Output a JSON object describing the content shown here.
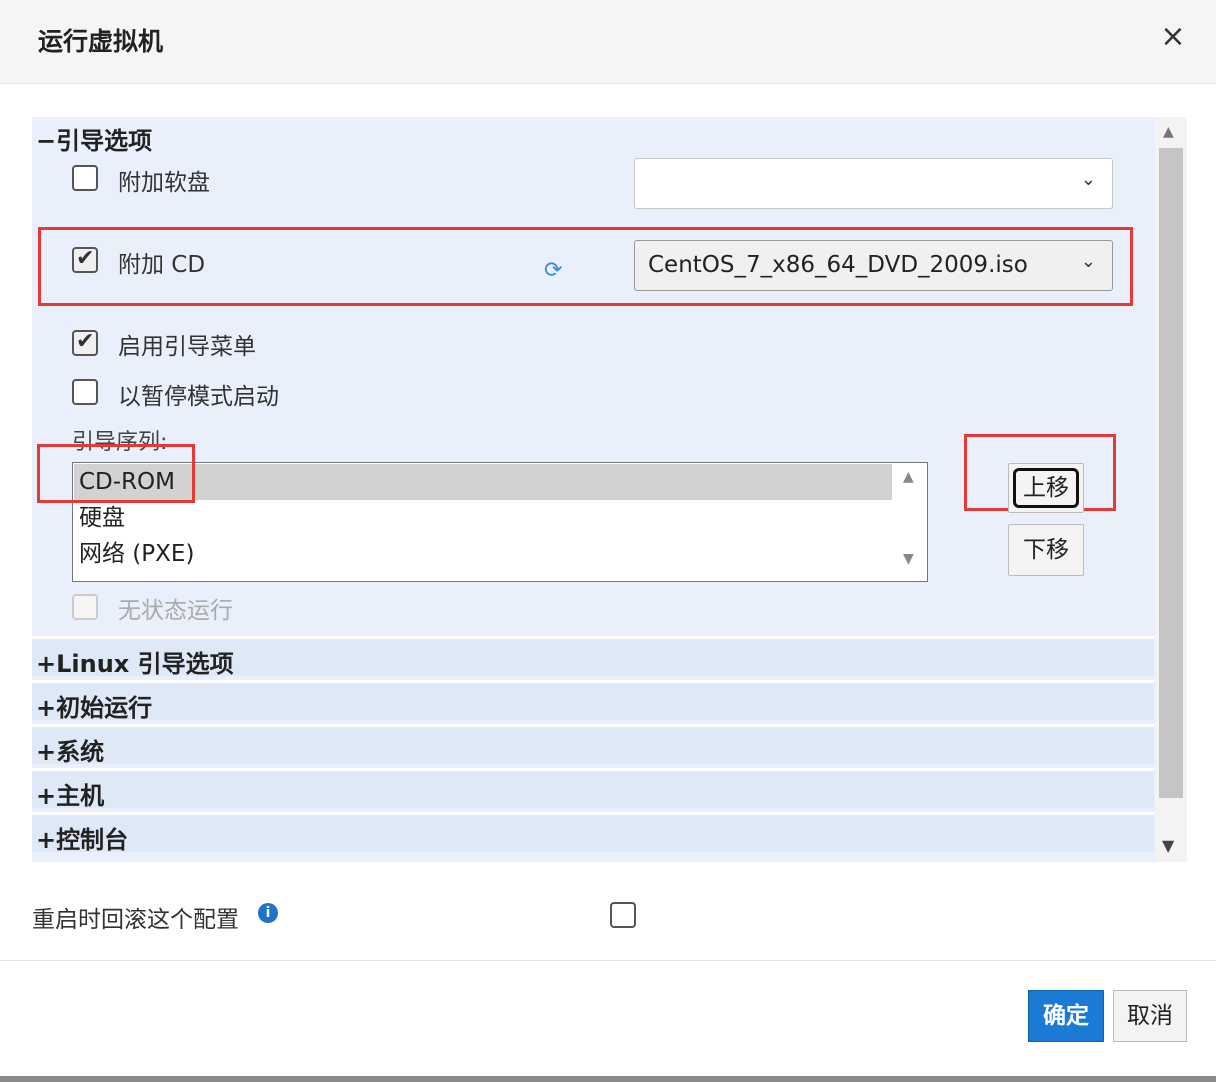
{
  "dialog": {
    "title": "运行虚拟机",
    "close_icon": "×"
  },
  "boot_options": {
    "header": "−引导选项",
    "attach_floppy": {
      "label": "附加软盘",
      "checked": false,
      "value": ""
    },
    "attach_cd": {
      "label": "附加 CD",
      "checked": true,
      "value": "CentOS_7_x86_64_DVD_2009.iso"
    },
    "enable_boot_menu": {
      "label": "启用引导菜单",
      "checked": true
    },
    "start_paused": {
      "label": "以暂停模式启动",
      "checked": false
    },
    "boot_sequence_label": "引导序列:",
    "boot_sequence": [
      "CD-ROM",
      "硬盘",
      "网络 (PXE)"
    ],
    "selected_index": 0,
    "move_up": "上移",
    "move_down": "下移",
    "stateless": {
      "label": "无状态运行",
      "checked": false,
      "disabled": true
    }
  },
  "sections": [
    "+Linux 引导选项",
    "+初始运行",
    "+系统",
    "+主机",
    "+控制台"
  ],
  "footer": {
    "rollback_label": "重启时回滚这个配置",
    "rollback_checked": false,
    "info_icon": "i",
    "ok": "确定",
    "cancel": "取消"
  },
  "colors": {
    "primary": "#1a7bd4",
    "highlight_box": "#e53935",
    "panel_bg": "#e9f0fb"
  }
}
